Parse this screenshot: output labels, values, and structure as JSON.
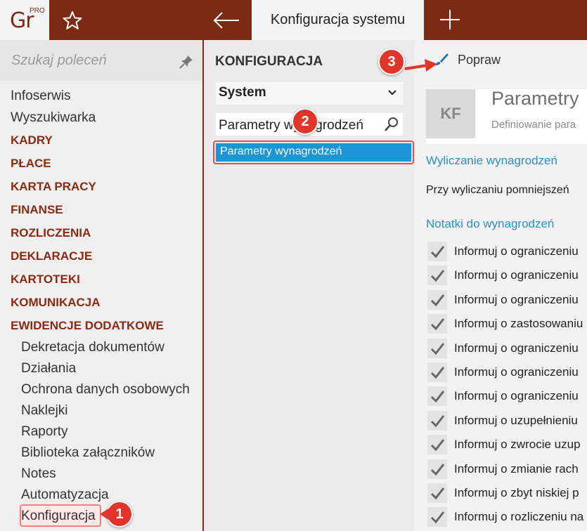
{
  "topbar": {
    "logo_text": "Gr",
    "logo_badge": "PRO",
    "active_tab": "Konfiguracja systemu",
    "icons": [
      "star-icon",
      "back-arrow-icon",
      "plus-icon"
    ],
    "bg_color": "#7b2a14"
  },
  "sidebar": {
    "search_placeholder": "Szukaj poleceń",
    "items": [
      {
        "label": "Infoserwis",
        "kind": "plain"
      },
      {
        "label": "Wyszukiwarka",
        "kind": "plain"
      },
      {
        "label": "KADRY",
        "kind": "section"
      },
      {
        "label": "PŁACE",
        "kind": "section"
      },
      {
        "label": "KARTA PRACY",
        "kind": "section"
      },
      {
        "label": "FINANSE",
        "kind": "section"
      },
      {
        "label": "ROZLICZENIA",
        "kind": "section"
      },
      {
        "label": "DEKLARACJE",
        "kind": "section"
      },
      {
        "label": "KARTOTEKI",
        "kind": "section"
      },
      {
        "label": "KOMUNIKACJA",
        "kind": "section"
      },
      {
        "label": "EWIDENCJE DODATKOWE",
        "kind": "section"
      }
    ],
    "subitems": [
      "Dekretacja dokumentów",
      "Działania",
      "Ochrona danych osobowych",
      "Naklejki",
      "Raporty",
      "Biblioteka załączników",
      "Notes",
      "Automatyzacja",
      "Konfiguracja"
    ]
  },
  "middle": {
    "title": "KONFIGURACJA",
    "dropdown_value": "System",
    "filter_value": "Parametry wynagrodzeń",
    "selected_item": "Parametry wynagrodzeń",
    "selected_color": "#1b94d8"
  },
  "right": {
    "edit_label": "Popraw",
    "badge": "KF",
    "title": "Parametry",
    "subtitle": "Definiowanie para",
    "section1": "Wyliczanie wynagrodzeń",
    "line1": "Przy wyliczaniu pomniejszeń",
    "section2": "Notatki do wynagrodzeń",
    "checks": [
      "Informuj o ograniczeniu",
      "Informuj o ograniczeniu",
      "Informuj o ograniczeniu",
      "Informuj o zastosowaniu",
      "Informuj o ograniczeniu",
      "Informuj o ograniczeniu",
      "Informuj o ograniczeniu",
      "Informuj o uzupełnieniu",
      "Informuj o zwrocie uzup",
      "Informuj o zmianie rach",
      "Informuj o zbyt niskiej p",
      "Informuj o rozliczeniu na"
    ],
    "link_color": "#2a8fc6"
  },
  "callouts": [
    "1",
    "2",
    "3"
  ]
}
